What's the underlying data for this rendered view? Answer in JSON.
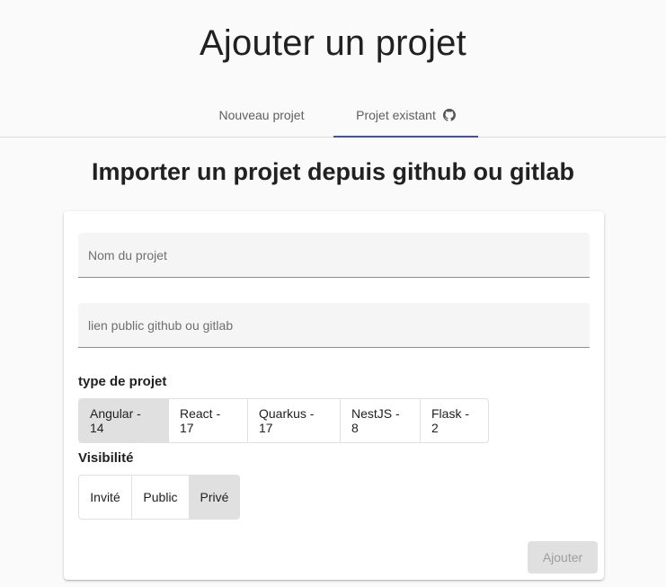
{
  "header": {
    "title": "Ajouter un projet"
  },
  "tabs": [
    {
      "label": "Nouveau projet",
      "active": false
    },
    {
      "label": "Projet existant",
      "active": true,
      "icon": "github-icon"
    }
  ],
  "section": {
    "title": "Importer un projet depuis github ou gitlab"
  },
  "form": {
    "name_field": {
      "placeholder": "Nom du projet",
      "value": ""
    },
    "link_field": {
      "placeholder": "lien public github ou gitlab",
      "value": ""
    },
    "project_type": {
      "label": "type de projet",
      "options": [
        "Angular - 14",
        "React - 17",
        "Quarkus - 17",
        "NestJS - 8",
        "Flask - 2"
      ],
      "selected": "Angular - 14"
    },
    "visibility": {
      "label": "Visibilité",
      "options": [
        "Invité",
        "Public",
        "Privé"
      ],
      "selected": "Privé"
    },
    "submit_label": "Ajouter",
    "submit_disabled": true
  },
  "colors": {
    "accent": "#3f51b5",
    "selected_toggle": "#e0e0e0",
    "background": "#fafafa"
  }
}
